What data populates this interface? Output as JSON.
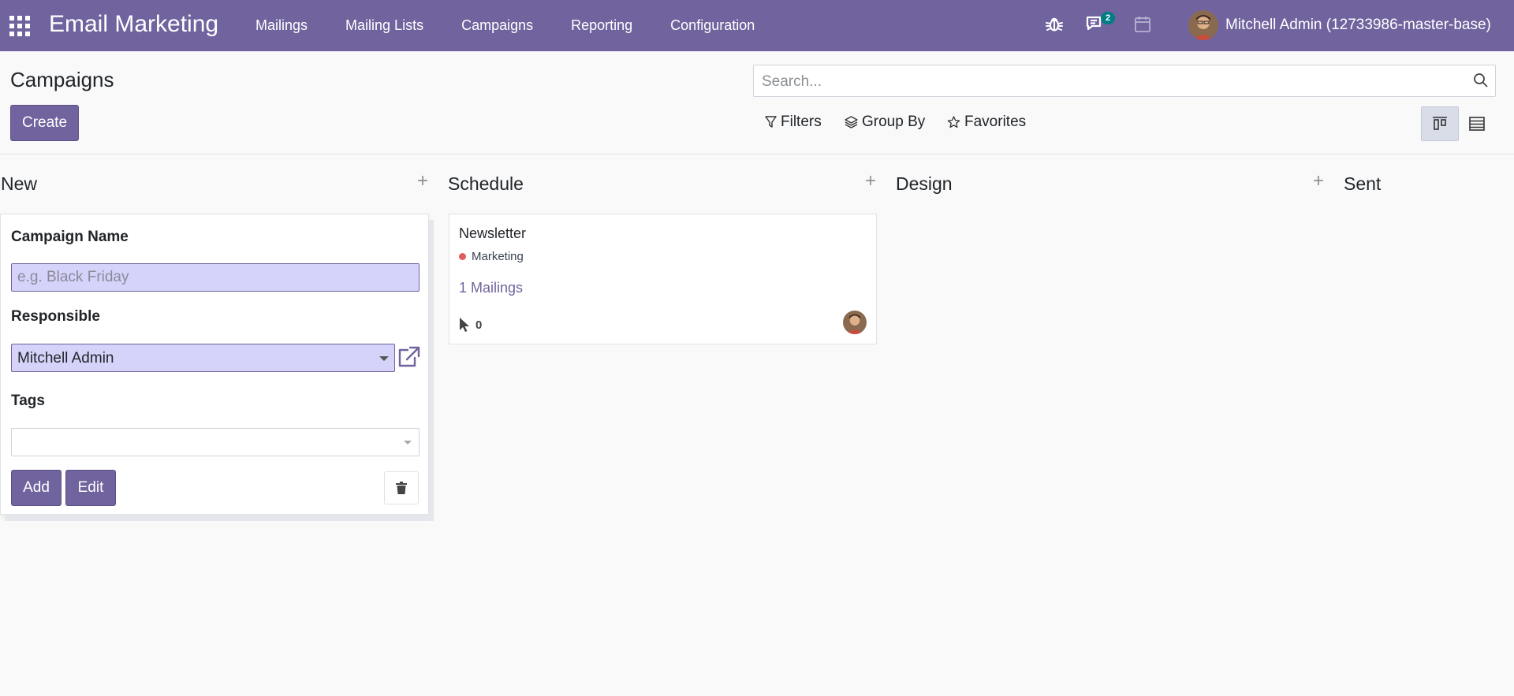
{
  "navbar": {
    "app_title": "Email Marketing",
    "menu": [
      {
        "label": "Mailings"
      },
      {
        "label": "Mailing Lists"
      },
      {
        "label": "Campaigns"
      },
      {
        "label": "Reporting"
      },
      {
        "label": "Configuration"
      }
    ],
    "systray": {
      "debug_icon": "bug-icon",
      "messages_icon": "chat-icon",
      "messages_count": "2",
      "activities_icon": "calendar-icon"
    },
    "user_name": "Mitchell Admin (12733986-master-base)"
  },
  "control_panel": {
    "title": "Campaigns",
    "create_label": "Create",
    "search_placeholder": "Search...",
    "filters_label": "Filters",
    "group_by_label": "Group By",
    "favorites_label": "Favorites",
    "active_view": "kanban"
  },
  "kanban": {
    "columns": [
      {
        "title": "New"
      },
      {
        "title": "Schedule"
      },
      {
        "title": "Design"
      },
      {
        "title": "Sent"
      }
    ],
    "quick_create": {
      "name_label": "Campaign Name",
      "name_placeholder": "e.g. Black Friday",
      "name_value": "",
      "responsible_label": "Responsible",
      "responsible_value": "Mitchell Admin",
      "tags_label": "Tags",
      "add_label": "Add",
      "edit_label": "Edit"
    },
    "cards": [
      {
        "title": "Newsletter",
        "tag": "Marketing",
        "tag_color": "#e05d5d",
        "mailings": "1 Mailings",
        "clicks": "0"
      }
    ]
  },
  "colors": {
    "brand": "#71639e",
    "badge": "#017e84"
  }
}
